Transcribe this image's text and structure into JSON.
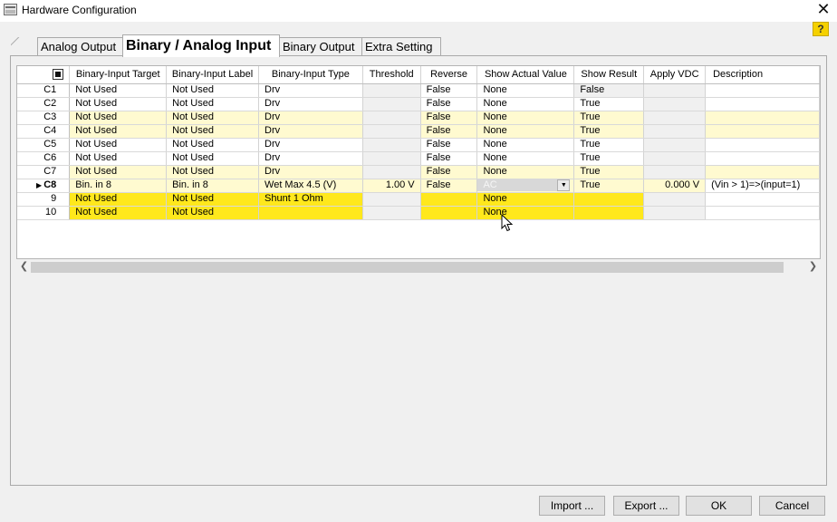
{
  "window": {
    "title": "Hardware Configuration",
    "help_label": "?"
  },
  "tabs": [
    {
      "label": "Analog Output",
      "active": false
    },
    {
      "label": "Binary / Analog Input",
      "active": true
    },
    {
      "label": "Binary Output",
      "active": false
    },
    {
      "label": "Extra Setting",
      "active": false
    }
  ],
  "grid": {
    "columns": [
      "Binary-Input Target",
      "Binary-Input Label",
      "Binary-Input Type",
      "Threshold",
      "Reverse",
      "Show Actual Value",
      "Show Result",
      "Apply VDC",
      "Description"
    ],
    "rows": [
      {
        "id": "C1",
        "cells": [
          "Not Used",
          "Not Used",
          "Drv",
          "",
          "False",
          "None",
          "False",
          "",
          ""
        ]
      },
      {
        "id": "C2",
        "cells": [
          "Not Used",
          "Not Used",
          "Drv",
          "",
          "False",
          "None",
          "True",
          "",
          ""
        ]
      },
      {
        "id": "C3",
        "cells": [
          "Not Used",
          "Not Used",
          "Drv",
          "",
          "False",
          "None",
          "True",
          "",
          ""
        ]
      },
      {
        "id": "C4",
        "cells": [
          "Not Used",
          "Not Used",
          "Drv",
          "",
          "False",
          "None",
          "True",
          "",
          ""
        ]
      },
      {
        "id": "C5",
        "cells": [
          "Not Used",
          "Not Used",
          "Drv",
          "",
          "False",
          "None",
          "True",
          "",
          ""
        ]
      },
      {
        "id": "C6",
        "cells": [
          "Not Used",
          "Not Used",
          "Drv",
          "",
          "False",
          "None",
          "True",
          "",
          ""
        ]
      },
      {
        "id": "C7",
        "cells": [
          "Not Used",
          "Not Used",
          "Drv",
          "",
          "False",
          "None",
          "True",
          "",
          ""
        ]
      },
      {
        "id": "C8",
        "cells": [
          "Bin. in 8",
          "Bin. in 8",
          "Wet Max 4.5 (V)",
          "1.00 V",
          "False",
          "AC",
          "True",
          "0.000 V",
          "(Vin > 1)=>(input=1)"
        ]
      },
      {
        "id": "9",
        "cells": [
          "Not Used",
          "Not Used",
          "Shunt 1 Ohm",
          "",
          "",
          "None",
          "",
          "",
          ""
        ]
      },
      {
        "id": "10",
        "cells": [
          "Not Used",
          "Not Used",
          "",
          "",
          "",
          "None",
          "",
          "",
          ""
        ]
      }
    ]
  },
  "buttons": {
    "import": "Import ...",
    "export": "Export ...",
    "ok": "OK",
    "cancel": "Cancel"
  },
  "colors": {
    "pale_yellow": "#fffad0",
    "bright_yellow": "#ffe81c",
    "disabled_gray": "#f0f0f0",
    "help_yellow": "#f5d100"
  }
}
